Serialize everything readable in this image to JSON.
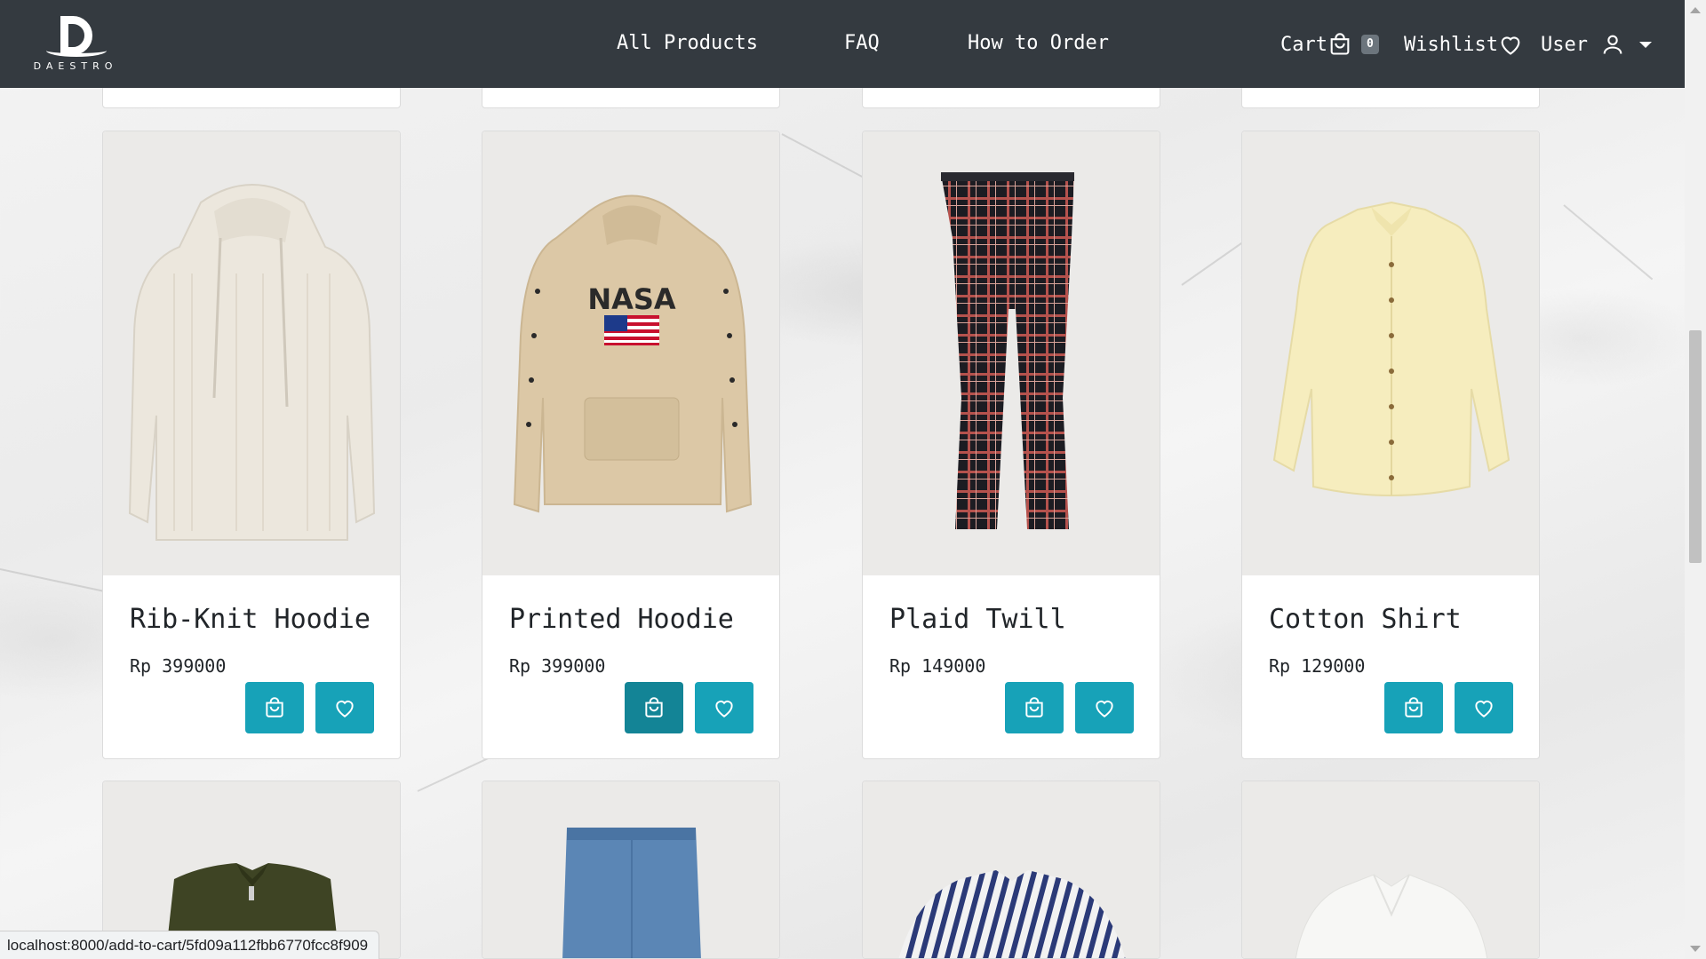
{
  "brand": {
    "name": "DAESTRO"
  },
  "nav": {
    "links": [
      "All Products",
      "FAQ",
      "How to Order"
    ],
    "cart_label": "Cart",
    "cart_count": "0",
    "wishlist_label": "Wishlist",
    "user_label": "User"
  },
  "products": [
    {
      "name": "Rib-Knit Hoodie",
      "price": "Rp 399000"
    },
    {
      "name": "Printed Hoodie",
      "price": "Rp 399000"
    },
    {
      "name": "Plaid Twill",
      "price": "Rp 149000"
    },
    {
      "name": "Cotton Shirt",
      "price": "Rp 129000"
    }
  ],
  "status_url": "localhost:8000/add-to-cart/5fd09a112fbb6770fcc8f909",
  "colors": {
    "navbar": "#343a40",
    "button": "#17a2b8",
    "button_active": "#138496"
  }
}
